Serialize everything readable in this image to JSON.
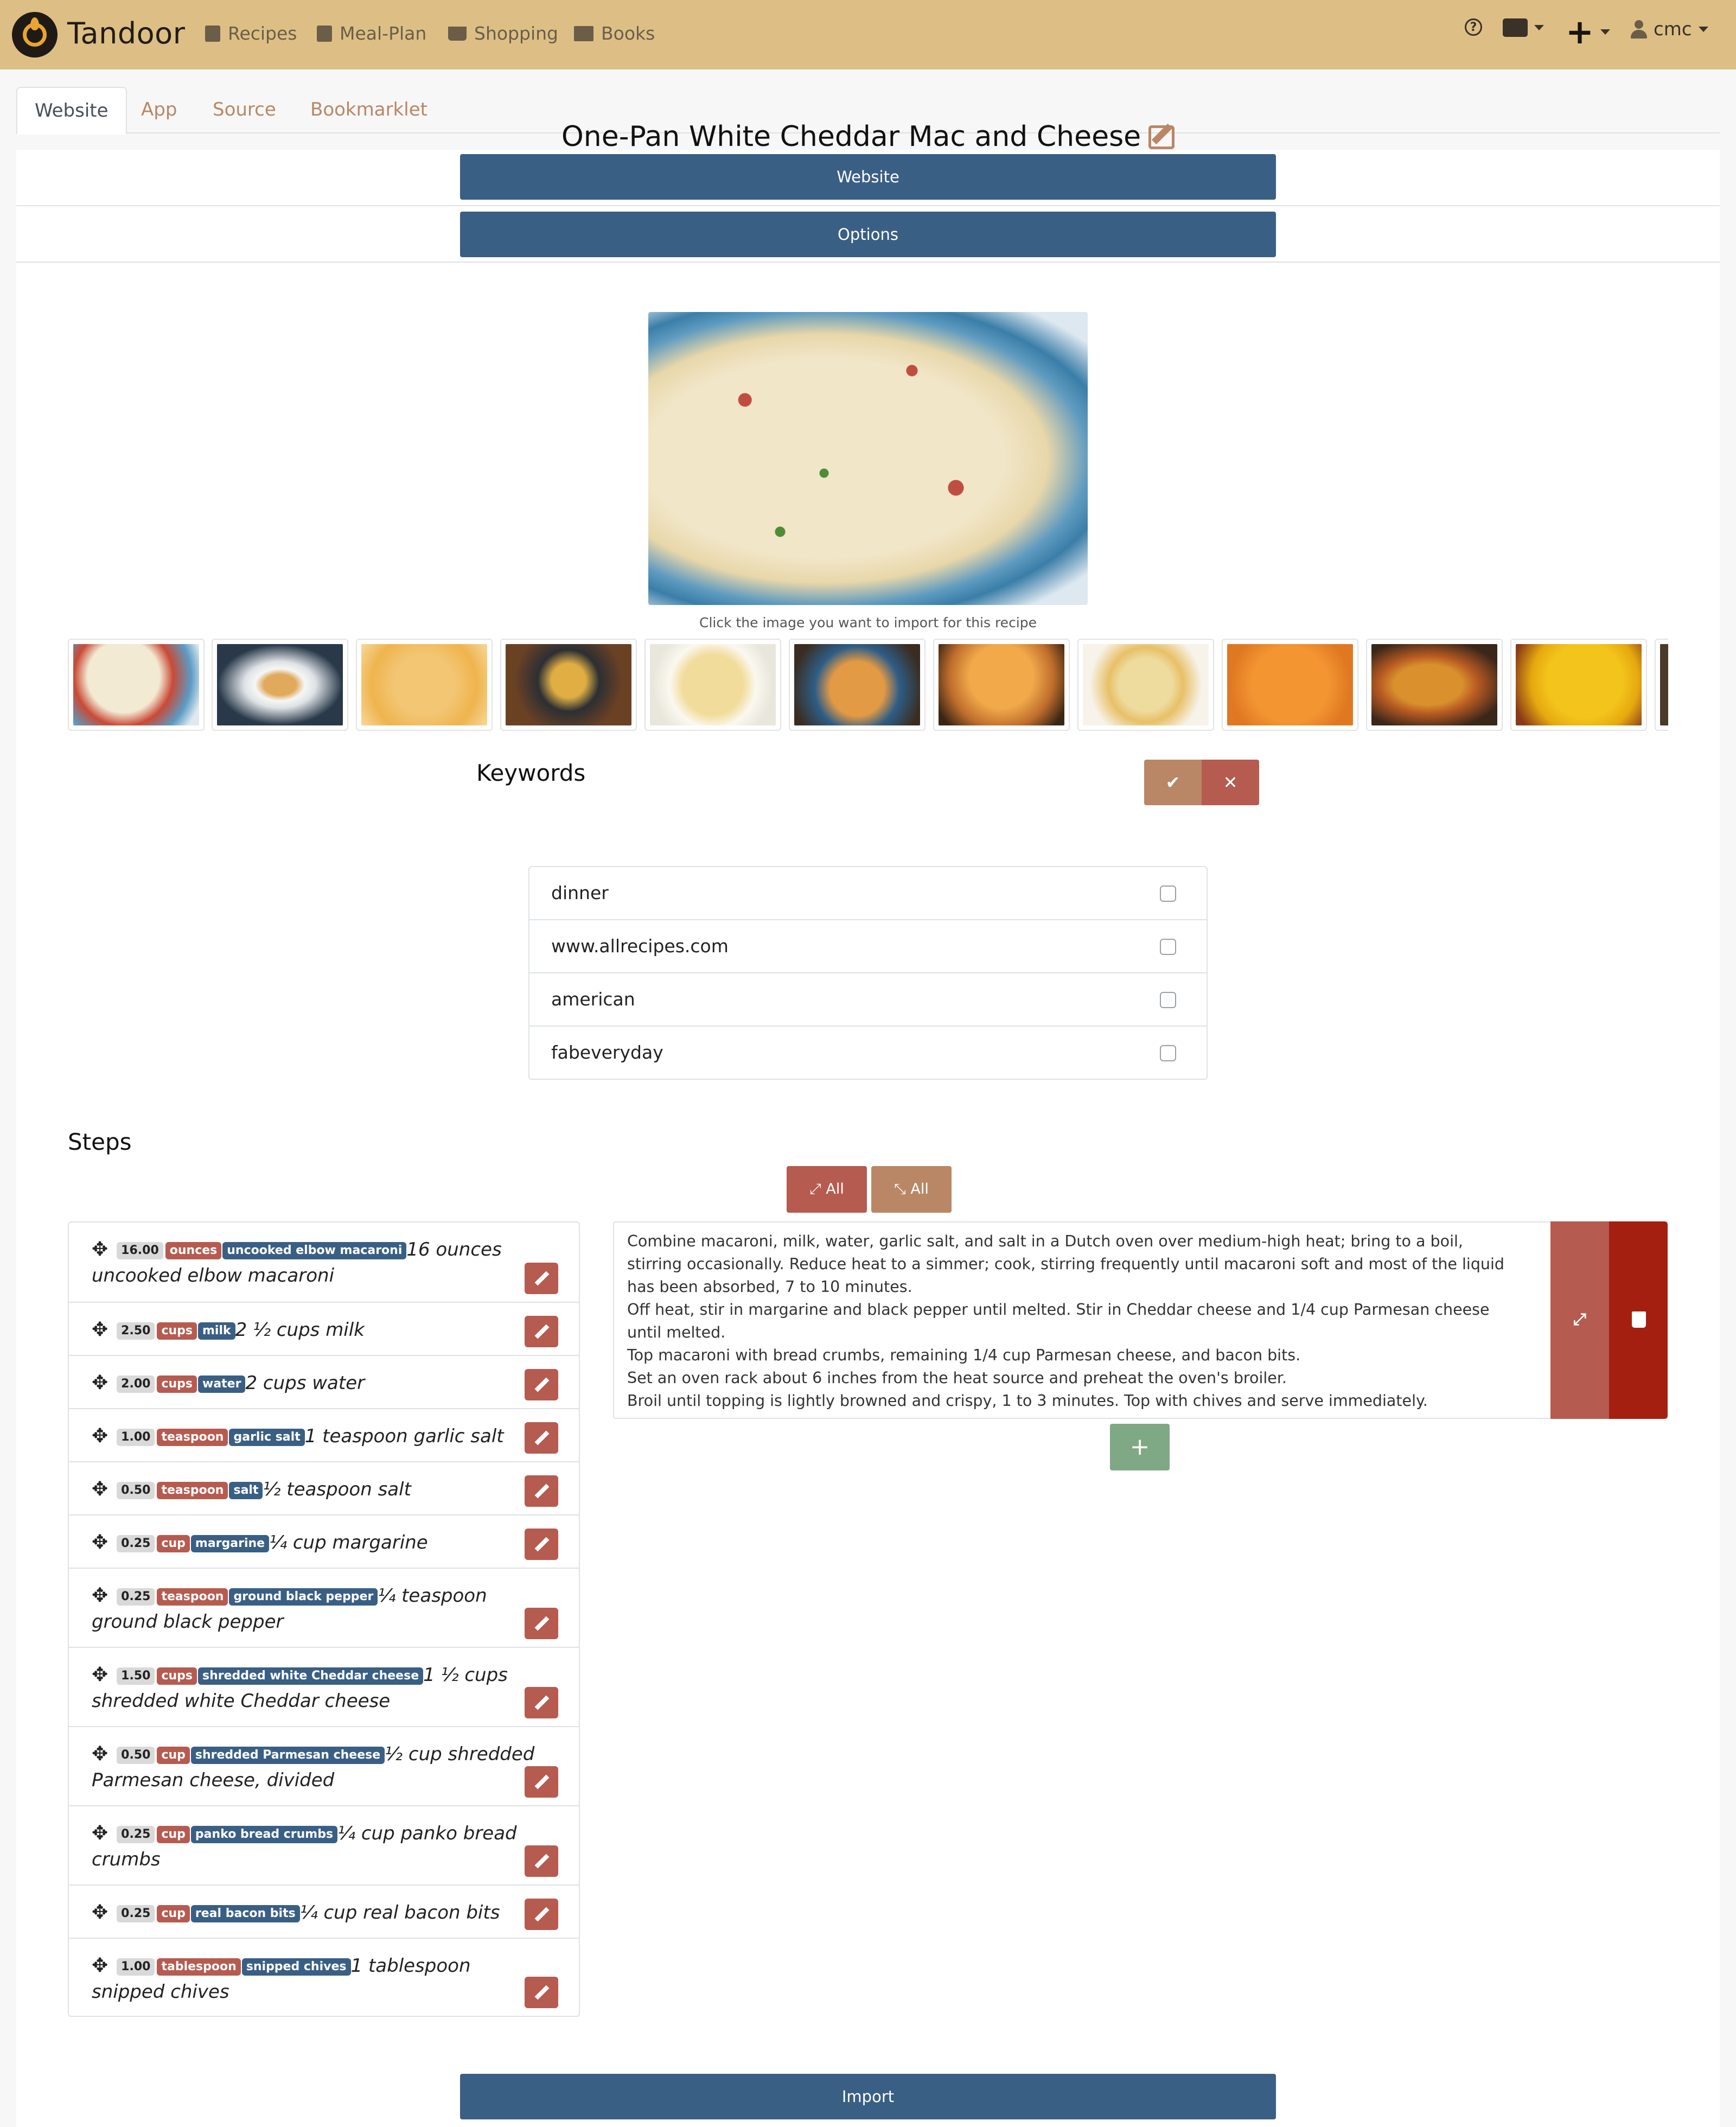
{
  "navbar": {
    "brand": "Tandoor",
    "items": [
      {
        "label": "Recipes",
        "icon": "recipe-book-icon"
      },
      {
        "label": "Meal-Plan",
        "icon": "calendar-icon"
      },
      {
        "label": "Shopping",
        "icon": "shopping-cart-icon"
      },
      {
        "label": "Books",
        "icon": "books-icon"
      }
    ],
    "user": "cmc"
  },
  "tabs": [
    "Website",
    "App",
    "Source",
    "Bookmarklet"
  ],
  "active_tab": "Website",
  "sections": {
    "website_label": "Website",
    "options_label": "Options"
  },
  "recipe": {
    "title": "One-Pan White Cheddar Mac and Cheese",
    "image_caption": "Click the image you want to import for this recipe"
  },
  "keywords": {
    "title": "Keywords",
    "items": [
      "dinner",
      "www.allrecipes.com",
      "american",
      "fabeveryday"
    ]
  },
  "steps": {
    "title": "Steps",
    "expand_all_label": "All",
    "collapse_all_label": "All",
    "ingredients": [
      {
        "amount": "16.00",
        "unit": "ounces",
        "food": "uncooked elbow macaroni",
        "text": "16 ounces uncooked elbow macaroni"
      },
      {
        "amount": "2.50",
        "unit": "cups",
        "food": "milk",
        "text": "2 ½ cups milk"
      },
      {
        "amount": "2.00",
        "unit": "cups",
        "food": "water",
        "text": "2 cups water"
      },
      {
        "amount": "1.00",
        "unit": "teaspoon",
        "food": "garlic salt",
        "text": "1 teaspoon garlic salt"
      },
      {
        "amount": "0.50",
        "unit": "teaspoon",
        "food": "salt",
        "text": "½ teaspoon salt"
      },
      {
        "amount": "0.25",
        "unit": "cup",
        "food": "margarine",
        "text": "¼ cup margarine"
      },
      {
        "amount": "0.25",
        "unit": "teaspoon",
        "food": "ground black pepper",
        "text": "¼ teaspoon ground black pepper"
      },
      {
        "amount": "1.50",
        "unit": "cups",
        "food": "shredded white Cheddar cheese",
        "text": "1 ½ cups shredded white Cheddar cheese"
      },
      {
        "amount": "0.50",
        "unit": "cup",
        "food": "shredded Parmesan cheese",
        "text": "½ cup shredded Parmesan cheese, divided"
      },
      {
        "amount": "0.25",
        "unit": "cup",
        "food": "panko bread crumbs",
        "text": "¼ cup panko bread crumbs"
      },
      {
        "amount": "0.25",
        "unit": "cup",
        "food": "real bacon bits",
        "text": "¼ cup real bacon bits"
      },
      {
        "amount": "1.00",
        "unit": "tablespoon",
        "food": "snipped chives",
        "text": "1 tablespoon snipped chives"
      }
    ],
    "instructions": [
      "Combine macaroni, milk, water, garlic salt, and salt in a Dutch oven over medium-high heat; bring to a boil, stirring occasionally. Reduce heat to a simmer; cook, stirring frequently until macaroni soft and most of the liquid has been absorbed, 7 to 10 minutes.",
      "Off heat, stir in margarine and black pepper until melted. Stir in Cheddar cheese and 1/4 cup Parmesan cheese until melted.",
      "Top macaroni with bread crumbs, remaining 1/4 cup Parmesan cheese, and bacon bits.",
      "Set an oven rack about 6 inches from the heat source and preheat the oven's broiler.",
      "Broil until topping is lightly browned and crispy, 1 to 3 minutes. Top with chives and serve immediately."
    ],
    "add_step_label": "+"
  },
  "import_label": "Import",
  "colors": {
    "navbar": "#ddbf86",
    "primary": "#3a5f85",
    "danger": "#b65b50",
    "accent": "#b98766",
    "success": "#7fa885"
  }
}
